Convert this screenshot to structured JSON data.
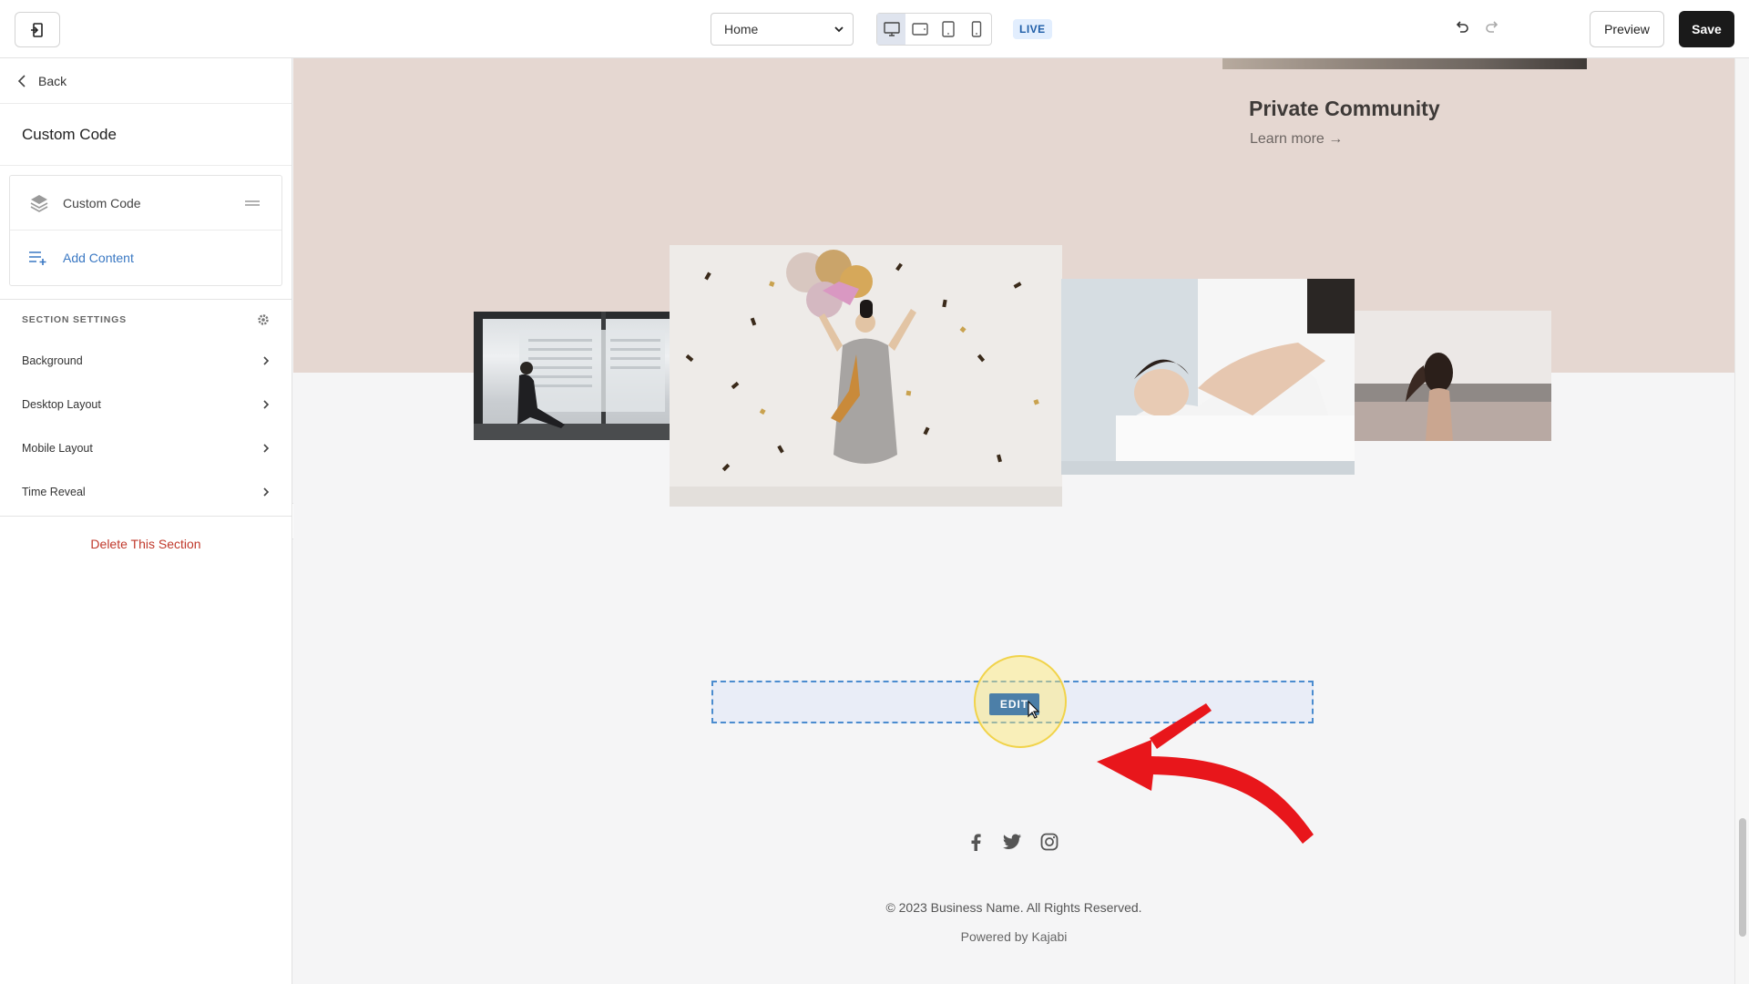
{
  "topbar": {
    "page_select_value": "Home",
    "live_label": "LIVE",
    "preview_label": "Preview",
    "save_label": "Save"
  },
  "sidebar": {
    "back_label": "Back",
    "title": "Custom Code",
    "block_label": "Custom Code",
    "add_content_label": "Add Content",
    "section_settings_label": "SECTION SETTINGS",
    "settings": [
      {
        "label": "Background"
      },
      {
        "label": "Desktop Layout"
      },
      {
        "label": "Mobile Layout"
      },
      {
        "label": "Time Reveal"
      }
    ],
    "delete_label": "Delete This Section"
  },
  "canvas": {
    "community_title": "Private Community",
    "community_link": "Learn more →",
    "edit_label": "EDIT",
    "copyright": "© 2023 Business Name. All Rights Reserved.",
    "powered_by": "Powered by Kajabi"
  },
  "icons": {
    "exit": "exit-icon",
    "undo": "undo-icon",
    "redo": "redo-icon",
    "back": "chevron-left-icon",
    "layers": "layers-icon",
    "add_content": "add-list-icon",
    "gear": "gear-icon",
    "social": [
      "facebook-icon",
      "twitter-icon",
      "instagram-icon"
    ]
  },
  "colors": {
    "accent": "#3a78c3",
    "danger": "#c0392b",
    "save_bg": "#1a1a1a",
    "edit_zone_border": "#4b8ccf",
    "annotation_arrow": "#e8161b",
    "pink_section": "#e5d7d1"
  }
}
